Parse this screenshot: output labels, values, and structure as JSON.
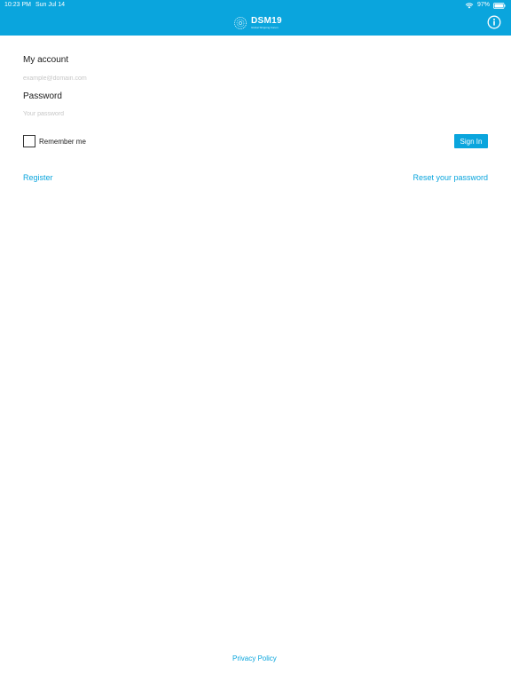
{
  "status_bar": {
    "time": "10:23 PM",
    "date": "Sun Jul 14",
    "battery_percent": "97%",
    "icons": [
      "wifi-icon",
      "battery-icon"
    ]
  },
  "nav": {
    "brand_name": "DSM19",
    "brand_tagline": "Global Shipping Forum",
    "info_icon": "info-icon",
    "accent_color": "#0aa5dd"
  },
  "form": {
    "account_label": "My account",
    "email_placeholder": "example@domain.com",
    "email_value": "",
    "password_label": "Password",
    "password_placeholder": "Your password",
    "password_value": "",
    "remember_label": "Remember me",
    "remember_checked": false,
    "signin_label": "Sign In"
  },
  "links": {
    "register": "Register",
    "reset_password": "Reset your password",
    "privacy_policy": "Privacy Policy"
  }
}
